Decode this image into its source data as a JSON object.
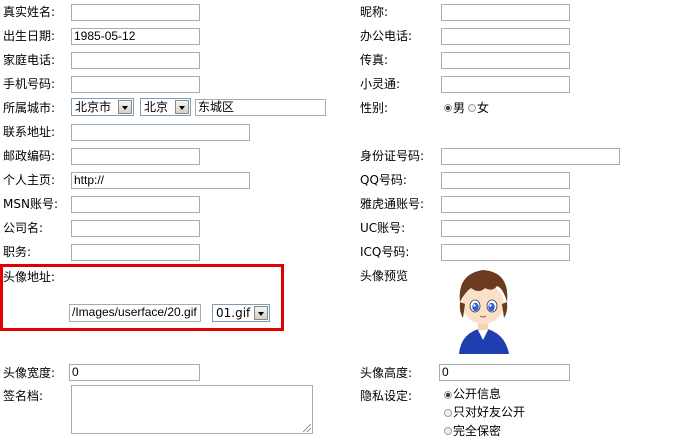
{
  "left_labels": {
    "real_name": "真实姓名:",
    "birth_date": "出生日期:",
    "home_phone": "家庭电话:",
    "mobile": "手机号码:",
    "city": "所属城市:",
    "address": "联系地址:",
    "postcode": "邮政编码:",
    "homepage": "个人主页:",
    "msn": "MSN账号:",
    "company": "公司名:",
    "position": "职务:",
    "avatar_url": "头像地址:",
    "avatar_width": "头像宽度:",
    "signature": "签名档:"
  },
  "right_labels": {
    "nickname": "昵称:",
    "office_phone": "办公电话:",
    "fax": "传真:",
    "phs": "小灵通:",
    "gender": "性别:",
    "id_number": "身份证号码:",
    "qq": "QQ号码:",
    "yahoo": "雅虎通账号:",
    "uc": "UC账号:",
    "icq": "ICQ号码:",
    "avatar_preview": "头像预览",
    "avatar_height": "头像高度:",
    "privacy": "隐私设定:"
  },
  "values": {
    "real_name": "",
    "birth_date": "1985-05-12",
    "home_phone": "",
    "mobile": "",
    "province": "北京市",
    "city": "北京",
    "district": "东城区",
    "address": "",
    "postcode": "",
    "homepage": "http://",
    "msn": "",
    "company": "",
    "position": "",
    "avatar_url": "/Images/userface/20.gif",
    "avatar_file": "01.gif",
    "avatar_width": "0",
    "nickname": "",
    "office_phone": "",
    "fax": "",
    "phs": "",
    "id_number": "",
    "qq": "",
    "yahoo": "",
    "uc": "",
    "icq": "",
    "avatar_height": "0",
    "signature": ""
  },
  "gender_options": [
    {
      "label": "男",
      "selected": true
    },
    {
      "label": "女",
      "selected": false
    }
  ],
  "privacy_options": [
    {
      "label": "公开信息",
      "selected": true
    },
    {
      "label": "只对好友公开",
      "selected": false
    },
    {
      "label": "完全保密",
      "selected": false
    }
  ],
  "colors": {
    "highlight_border": "#e00000",
    "input_border": "#a5acb2"
  },
  "icons": {
    "avatar_preview": "anime-boy-avatar"
  }
}
